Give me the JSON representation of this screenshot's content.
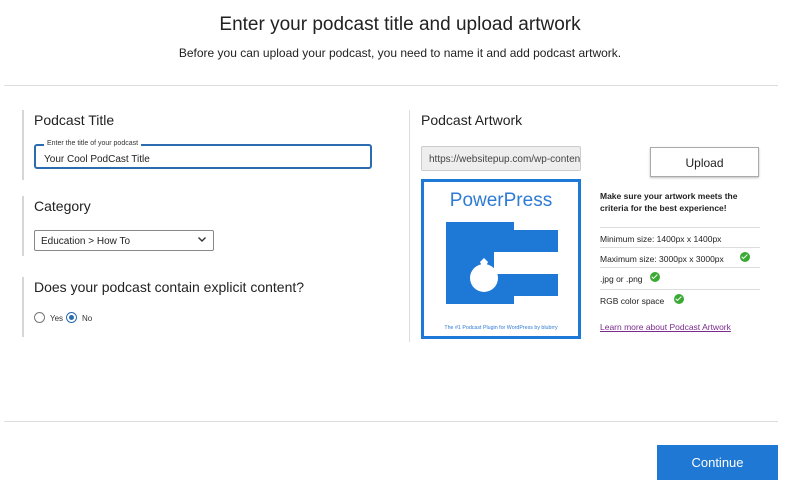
{
  "header": {
    "title": "Enter your podcast title and upload artwork",
    "subtitle": "Before you can upload your podcast, you need to name it and add podcast artwork."
  },
  "podcast_title": {
    "heading": "Podcast Title",
    "field_label": "Enter the title of your podcast",
    "value": "Your Cool PodCast Title"
  },
  "category": {
    "heading": "Category",
    "selected": "Education > How To"
  },
  "explicit": {
    "heading": "Does your podcast contain explicit content?",
    "options": [
      {
        "label": "Yes",
        "checked": false
      },
      {
        "label": "No",
        "checked": true
      }
    ]
  },
  "artwork": {
    "heading": "Podcast Artwork",
    "url_value": "https://websitepup.com/wp-content",
    "upload_label": "Upload",
    "image_brand": "PowerPress",
    "image_tagline": "The #1 Podcast Plugin for WordPress by blubrry",
    "criteria_heading": "Make sure your artwork meets the criteria for the best experience!",
    "criteria": [
      {
        "text": "Minimum size: 1400px x 1400px",
        "check": false
      },
      {
        "text": "Maximum size: 3000px x 3000px",
        "check": true
      },
      {
        "text": ".jpg or .png",
        "check": true
      },
      {
        "text": "RGB color space",
        "check": true
      }
    ],
    "learn_more": "Learn more about Podcast Artwork"
  },
  "footer": {
    "continue_label": "Continue"
  },
  "colors": {
    "primary_blue": "#1e78d4",
    "check_green": "#3aaa35",
    "link_purple": "#7a2b8b"
  }
}
